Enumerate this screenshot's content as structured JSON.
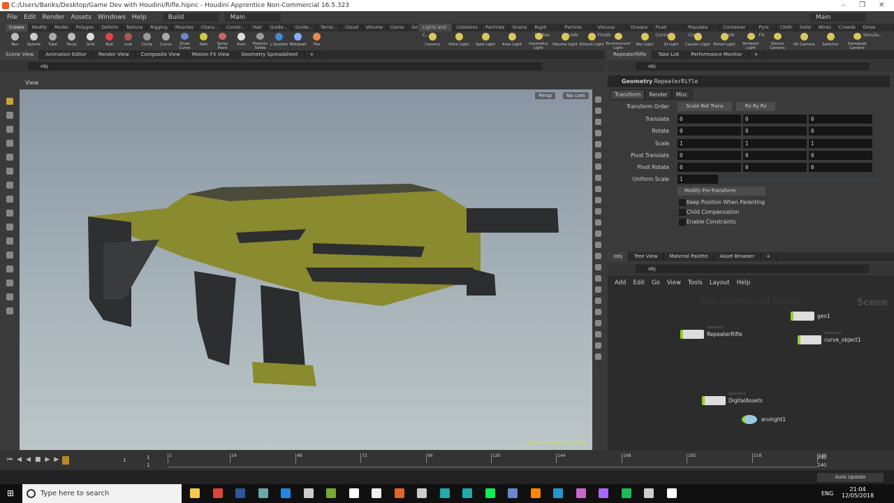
{
  "window": {
    "title": "C:/Users/Banks/Desktop/Game Dev with Houdini/Rifle.hipnc - Houdini Apprentice Non-Commercial 16.5.323"
  },
  "menu": [
    "File",
    "Edit",
    "Render",
    "Assets",
    "Windows",
    "Help"
  ],
  "desktop": "Build",
  "desktop2": "Main",
  "desktop_right": "Main",
  "shelf_tabs_left": [
    "Create",
    "Modify",
    "Model",
    "Polygon",
    "Deform",
    "Texture",
    "Rigging",
    "Muscles",
    "Chara...",
    "Constr...",
    "Hair U...",
    "Guide...",
    "Guide...",
    "Terrai...",
    "Cloud FX",
    "Volume",
    "Game D...",
    "Go Z"
  ],
  "shelf_tabs_right": [
    "Lights and C...",
    "Collisions",
    "Particles",
    "Grains",
    "Rigid Bodies",
    "Particle Fluids",
    "Viscous Fluids",
    "Oceans",
    "Fluid Contai...",
    "Populate Con...",
    "Container Tools",
    "Pyro FX",
    "Cloth",
    "Solid",
    "Wires",
    "Crowds",
    "Drive Simula..."
  ],
  "tools_left": [
    "Box",
    "Sphere",
    "Tube",
    "Torus",
    "Grid",
    "Null",
    "Line",
    "Circle",
    "Curve",
    "Draw Curve",
    "Path",
    "Spray Paint",
    "Font",
    "Platonic Solids",
    "L-System",
    "Metaball",
    "File"
  ],
  "tools_right": [
    "Camera",
    "Point Light",
    "Spot Light",
    "Area Light",
    "Geometry Light",
    "Volume Light",
    "Distant Light",
    "Environment Light",
    "Sky Light",
    "GI Light",
    "Caustic Light",
    "Portal Light",
    "Ambient Light",
    "Stereo Camera",
    "VR Camera",
    "Switcher",
    "Gamepad Camera"
  ],
  "left_pane_tabs": [
    "Scene View",
    "Animation Editor",
    "Render View",
    "Composite View",
    "Motion FX View",
    "Geometry Spreadsheet"
  ],
  "right_pane_tabs": [
    "RepeaterRifle",
    "Take List",
    "Performance Monitor"
  ],
  "network_tabs": [
    "/obj",
    "Tree View",
    "Material Palette",
    "Asset Browser"
  ],
  "path": "obj",
  "viewport": {
    "label": "View",
    "persp": "Persp",
    "cam": "No cam",
    "watermark": "Non-Commercial Edition",
    "body_color": "#8a8a2e"
  },
  "params": {
    "node_type": "Geometry",
    "node_name": "RepeaterRifle",
    "tabs": [
      "Transform",
      "Render",
      "Misc"
    ],
    "transform_order_label": "Transform Order",
    "transform_order": "Scale Rot Trans",
    "rot_order": "Rx Ry Rz",
    "rows": [
      {
        "label": "Translate",
        "v": [
          "0",
          "0",
          "0"
        ]
      },
      {
        "label": "Rotate",
        "v": [
          "0",
          "0",
          "0"
        ]
      },
      {
        "label": "Scale",
        "v": [
          "1",
          "1",
          "1"
        ]
      },
      {
        "label": "Pivot Translate",
        "v": [
          "0",
          "0",
          "0"
        ]
      },
      {
        "label": "Pivot Rotate",
        "v": [
          "0",
          "0",
          "0"
        ]
      }
    ],
    "uniform_scale_label": "Uniform Scale",
    "uniform_scale": "1",
    "modify_pre": "Modify Pre-Transform",
    "checks": [
      "Keep Position When Parenting",
      "Child Compensation",
      "Enable Constraints"
    ]
  },
  "network": {
    "menu": [
      "Add",
      "Edit",
      "Go",
      "View",
      "Tools",
      "Layout",
      "Help"
    ],
    "watermark": "Non-Commercial Edition",
    "context": "Scene",
    "nodes": [
      {
        "name": "geo1",
        "type": ""
      },
      {
        "name": "RepeaterRifle",
        "type": "Geometry"
      },
      {
        "name": "curve_object1",
        "type": "Geometry"
      },
      {
        "name": "DigitalAssets",
        "type": "Geometry"
      },
      {
        "name": "envlight1",
        "type": ""
      }
    ]
  },
  "timeline": {
    "frame": "1",
    "start": "1",
    "start2": "1",
    "end": "240",
    "end2": "240",
    "ticks": [
      "1",
      "24",
      "48",
      "72",
      "96",
      "120",
      "144",
      "168",
      "192",
      "216",
      "240"
    ]
  },
  "status": {
    "update": "Auto Update"
  },
  "taskbar": {
    "search": "Type here to search",
    "lang": "ENG",
    "time": "21:04",
    "date": "12/05/2018"
  }
}
